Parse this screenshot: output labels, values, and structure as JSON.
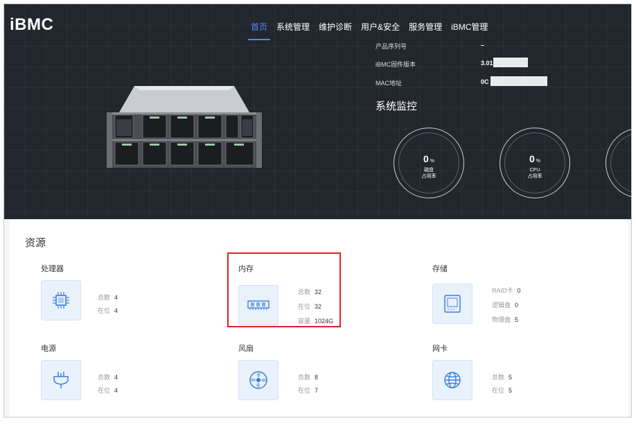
{
  "app": {
    "logo": "iBMC"
  },
  "nav": {
    "items": [
      {
        "label": "首页",
        "active": true
      },
      {
        "label": "系统管理"
      },
      {
        "label": "维护诊断"
      },
      {
        "label": "用户&安全"
      },
      {
        "label": "服务管理"
      },
      {
        "label": "iBMC管理"
      }
    ]
  },
  "info": {
    "rows": [
      {
        "label": "产品序列号",
        "value": "–"
      },
      {
        "label": "iBMC固件版本",
        "value": "3.01"
      },
      {
        "label": "MAC地址",
        "value": "0C"
      }
    ]
  },
  "monitor": {
    "title": "系统监控",
    "gauges": [
      {
        "value": "0",
        "unit": "%",
        "label_1": "磁盘",
        "label_2": "占用率"
      },
      {
        "value": "0",
        "unit": "%",
        "label_1": "CPU",
        "label_2": "占用率"
      }
    ]
  },
  "resources": {
    "title": "资源",
    "cpu": {
      "title": "处理器",
      "total_label": "总数",
      "total": "4",
      "present_label": "在位",
      "present": "4"
    },
    "memory": {
      "title": "内存",
      "total_label": "总数",
      "total": "32",
      "present_label": "在位",
      "present": "32",
      "capacity_label": "容量",
      "capacity": "1024G"
    },
    "storage": {
      "title": "存储",
      "raid_label": "RAID卡",
      "raid": "0",
      "logical_label": "逻辑盘",
      "logical": "0",
      "physical_label": "物理盘",
      "physical": "5"
    },
    "power": {
      "title": "电源",
      "total_label": "总数",
      "total": "4",
      "present_label": "在位",
      "present": "4"
    },
    "fan": {
      "title": "风扇",
      "total_label": "总数",
      "total": "8",
      "present_label": "在位",
      "present": "7"
    },
    "nic": {
      "title": "网卡",
      "total_label": "总数",
      "total": "5",
      "present_label": "在位",
      "present": "5"
    }
  },
  "colors": {
    "accent": "#4a8cf0",
    "hero_bg": "#22262d",
    "highlight": "#e0201f",
    "icon_bg": "#e9f1fb"
  }
}
